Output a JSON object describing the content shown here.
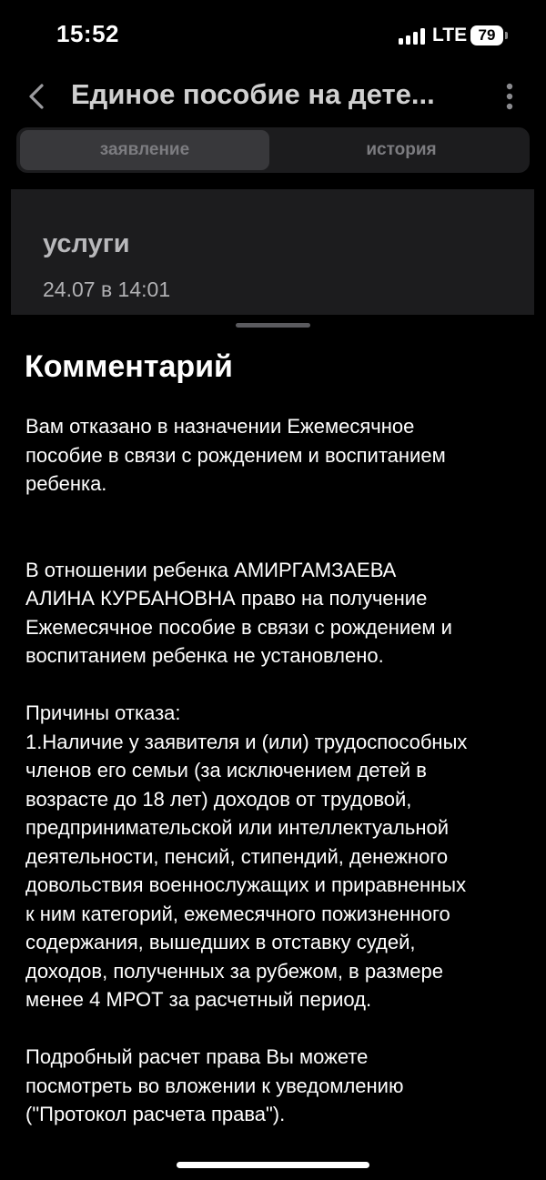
{
  "status_bar": {
    "time": "15:52",
    "network": "LTE",
    "battery": "79"
  },
  "header": {
    "title": "Единое пособие на дете...",
    "back_icon": "chevron-left-icon",
    "more_icon": "more-vertical-icon"
  },
  "tabs": [
    {
      "label": "заявление",
      "active": true
    },
    {
      "label": "история",
      "active": false
    }
  ],
  "service_card": {
    "title": "услуги",
    "date": "24.07 в 14:01"
  },
  "comment": {
    "title": "Комментарий",
    "paragraphs": [
      "Вам отказано в назначении Ежемесячное\nпособие в связи с рождением и воспитанием\nребенка.",
      "В отношении ребенка АМИРГАМЗАЕВА\nАЛИНА КУРБАНОВНА право на получение\nЕжемесячное пособие в связи с рождением и\nвоспитанием ребенка не установлено.",
      "Причины отказа:\n1.Наличие у заявителя и (или) трудоспособных\nчленов его семьи (за исключением детей в\nвозрасте до 18 лет) доходов от трудовой,\nпредпринимательской или интеллектуальной\nдеятельности, пенсий, стипендий, денежного\nдовольствия военнослужащих и приравненных\nк ним категорий, ежемесячного пожизненного\nсодержания, вышедших в отставку судей,\nдоходов, полученных за рубежом, в размере\nменее 4 МРОТ за расчетный период.",
      "Подробный расчет права Вы можете\nпосмотреть во вложении к уведомлению\n(\"Протокол расчета права\")."
    ]
  },
  "colors": {
    "background": "#000000",
    "surface": "#1c1c1e",
    "active_tab": "#38383b",
    "muted_text": "#7c7c80"
  }
}
